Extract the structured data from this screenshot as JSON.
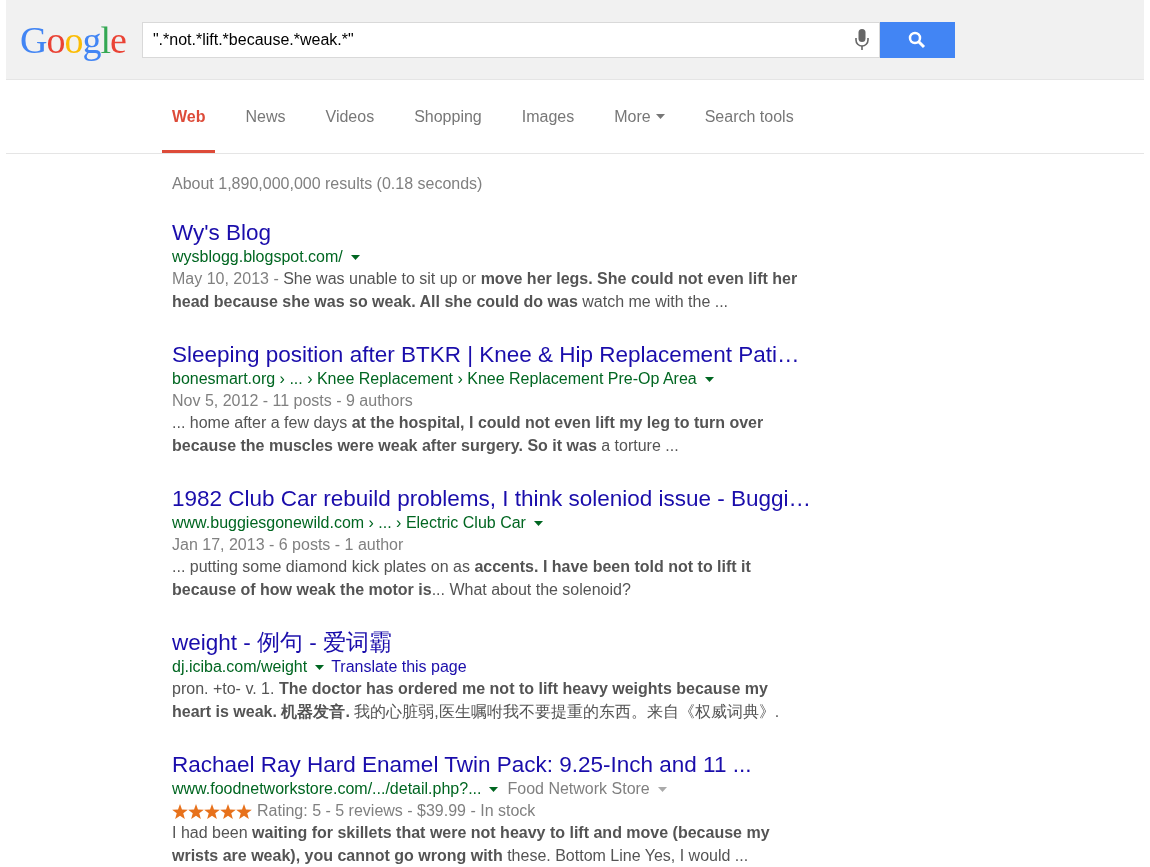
{
  "logo": "Google",
  "search": {
    "value": "\".*not.*lift.*because.*weak.*\""
  },
  "tabs": [
    {
      "label": "Web",
      "selected": true,
      "dropdown": false
    },
    {
      "label": "News",
      "selected": false,
      "dropdown": false
    },
    {
      "label": "Videos",
      "selected": false,
      "dropdown": false
    },
    {
      "label": "Shopping",
      "selected": false,
      "dropdown": false
    },
    {
      "label": "Images",
      "selected": false,
      "dropdown": false
    },
    {
      "label": "More",
      "selected": false,
      "dropdown": true
    },
    {
      "label": "Search tools",
      "selected": false,
      "dropdown": false
    }
  ],
  "result_stats": "About 1,890,000,000 results (0.18 seconds)",
  "results": [
    {
      "title": "Wy's Blog",
      "url": "wysblogg.blogspot.com/",
      "date": "May 10, 2013 - ",
      "snippet": "She was unable to sit up or **move her legs. She could not even lift her head because she was so weak. All she could do was** watch me with the ..."
    },
    {
      "title": "Sleeping position after BTKR | Knee & Hip Replacement Pati…",
      "url": "bonesmart.org › ... › Knee Replacement › Knee Replacement Pre-Op Area",
      "meta": "Nov 5, 2012 - 11 posts - 9 authors",
      "snippet": "... home after a few days **at the hospital, I could not even lift my leg to turn over because the muscles were weak after surgery. So it was** a torture ..."
    },
    {
      "title": "1982 Club Car rebuild problems, I think soleniod issue - Buggi…",
      "url": "www.buggiesgonewild.com › ... › Electric Club Car",
      "meta": "Jan 17, 2013 - 6 posts - 1 author",
      "snippet": "... putting some diamond kick plates on as **accents. I have been told not to lift it because of how weak the motor is**... What about the solenoid?"
    },
    {
      "title": "weight - 例句 - 爱词霸",
      "url": "dj.iciba.com/weight",
      "translate": "Translate this page",
      "snippet": "pron. +to- v. 1. **The doctor has ordered me not to lift heavy weights because my heart is weak. 机器发音.** 我的心脏弱,医生嘱咐我不要提重的东西。来自《权威词典》."
    },
    {
      "title": "Rachael Ray Hard Enamel Twin Pack: 9.25-Inch and 11 ...",
      "url": "www.foodnetworkstore.com/.../detail.php?...",
      "source": "Food Network Store",
      "stars": 5,
      "rating": "Rating: 5 - 5 reviews - $39.99 - In stock",
      "snippet": "I had been **waiting for skillets that were not heavy to lift and move (because my wrists are weak), you cannot go wrong with** these. Bottom Line Yes, I would ..."
    }
  ]
}
